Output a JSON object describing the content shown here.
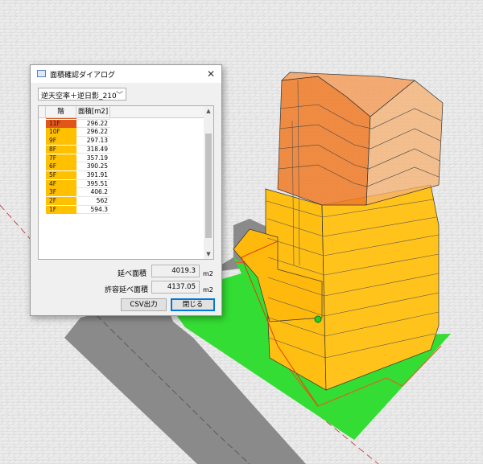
{
  "dialog": {
    "title": "面積確認ダイアログ",
    "close_glyph": "✕",
    "mode_select": {
      "value": "逆天空率＋逆日影_210",
      "chevron": "﹀"
    },
    "table": {
      "headers": [
        "階",
        "面積[m2]"
      ],
      "rows": [
        {
          "floor": "12F",
          "area": "298.22",
          "color": "#e0551a"
        },
        {
          "floor": "11F",
          "area": "296.22",
          "color": "#e0551a"
        },
        {
          "floor": "10F",
          "area": "296.22",
          "color": "#ffc000"
        },
        {
          "floor": "9F",
          "area": "297.13",
          "color": "#ffc000"
        },
        {
          "floor": "8F",
          "area": "318.49",
          "color": "#ffc000"
        },
        {
          "floor": "7F",
          "area": "357.19",
          "color": "#ffc000"
        },
        {
          "floor": "6F",
          "area": "390.25",
          "color": "#ffc000"
        },
        {
          "floor": "5F",
          "area": "391.91",
          "color": "#ffc000"
        },
        {
          "floor": "4F",
          "area": "395.51",
          "color": "#ffc000"
        },
        {
          "floor": "3F",
          "area": "406.2",
          "color": "#ffc000"
        },
        {
          "floor": "2F",
          "area": "562",
          "color": "#ffc000"
        },
        {
          "floor": "1F",
          "area": "594.3",
          "color": "#ffc000"
        }
      ]
    },
    "total_floor_area": {
      "label": "延べ面積",
      "value": "4019.3",
      "unit": "m2"
    },
    "allowed_floor_area": {
      "label": "許容延べ面積",
      "value": "4137.05",
      "unit": "m2"
    },
    "buttons": {
      "csv": "CSV出力",
      "close": "閉じる"
    }
  },
  "colors": {
    "site_green": "#33dd33",
    "road_gray": "#8a8a8a",
    "upper_floors": "#f07020",
    "lower_floors": "#ffbf10",
    "boundary_line": "#e04000"
  }
}
